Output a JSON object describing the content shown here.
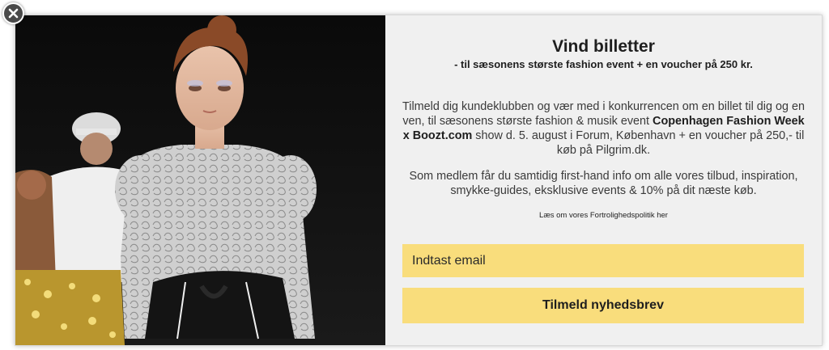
{
  "popup": {
    "title": "Vind billetter",
    "subtitle": "- til sæsonens største fashion event + en voucher på 250 kr.",
    "paragraph1": {
      "before": "Tilmeld dig kundeklubben og vær med i konkurrencen om en billet til dig og en ven, til sæsonens største fashion & musik event ",
      "bold": "Copenhagen Fashion Week x Boozt.com",
      "after": " show d. 5. august i Forum, København + en voucher på 250,- til køb på Pilgrim.dk."
    },
    "paragraph2": "Som medlem får du samtidig first-hand info om alle vores tilbud, inspiration, smykke-guides, eksklusive events & 10% på dit næste køb.",
    "privacy_link": "Læs om vores Fortrolighedspolitik her",
    "email_placeholder": "Indtast email",
    "submit_label": "Tilmeld nyhedsbrev",
    "close_icon": "close-icon",
    "image_icon": "runway-model-photo"
  },
  "colors": {
    "accent_yellow": "#f9dd7c",
    "panel_bg": "#f0f0f0",
    "text_dark": "#1e1e1e",
    "close_bg": "#4a4a4a"
  }
}
